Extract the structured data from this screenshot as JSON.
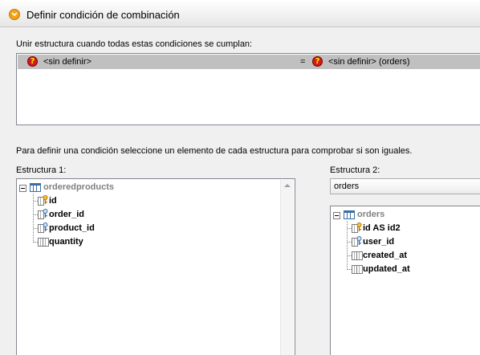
{
  "dialog": {
    "title": "Definir condición de combinación"
  },
  "instructions": {
    "join_label": "Unir estructura cuando todas estas condiciones se cumplan:",
    "define_hint": "Para definir una condición seleccione un elemento de cada estructura para comprobar si son iguales."
  },
  "conditions": [
    {
      "left": "<sin definir>",
      "operator": "=",
      "right": "<sin definir> (orders)"
    }
  ],
  "structure1": {
    "label": "Estructura 1:",
    "table": "orderedproducts",
    "columns": [
      {
        "name": "id",
        "key": "primary"
      },
      {
        "name": "order_id",
        "key": "foreign"
      },
      {
        "name": "product_id",
        "key": "foreign"
      },
      {
        "name": "quantity",
        "key": "none"
      }
    ]
  },
  "structure2": {
    "label": "Estructura 2:",
    "selected": "orders",
    "table": "orders",
    "columns": [
      {
        "name": "id AS id2",
        "key": "primary"
      },
      {
        "name": "user_id",
        "key": "foreign"
      },
      {
        "name": "created_at",
        "key": "none"
      },
      {
        "name": "updated_at",
        "key": "none"
      }
    ]
  },
  "icons": {
    "title": "altova-dialog-icon",
    "undefined": "question-icon",
    "table": "table-icon",
    "primary_key": "primary-key-icon",
    "foreign_key": "foreign-key-icon",
    "column": "column-icon",
    "collapse": "collapse-icon"
  },
  "colors": {
    "selected_row": "#c0c0c0",
    "question_icon": "#d11b1b",
    "primary_key": "#e08a00",
    "foreign_key": "#3a6ea5"
  }
}
